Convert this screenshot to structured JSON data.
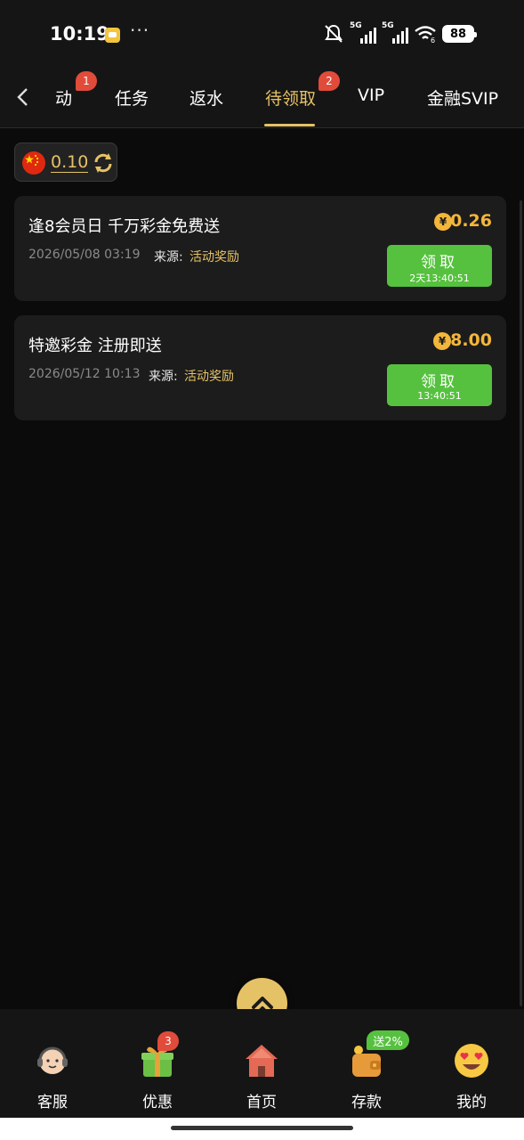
{
  "status_bar": {
    "time": "10:19",
    "dots": "···",
    "signal1_tag": "5G",
    "signal2_tag": "5G",
    "wifi_tag": "6",
    "battery": "88"
  },
  "tabs": {
    "items": [
      {
        "label": "动",
        "badge": "1"
      },
      {
        "label": "任务",
        "badge": ""
      },
      {
        "label": "返水",
        "badge": ""
      },
      {
        "label": "待领取",
        "badge": "2"
      },
      {
        "label": "VIP",
        "badge": ""
      },
      {
        "label": "金融SVIP",
        "badge": ""
      }
    ],
    "active_index": 3
  },
  "balance": {
    "value": "0.10"
  },
  "rewards": [
    {
      "title": "逢8会员日 千万彩金免费送",
      "date": "2026/05/08 03:19",
      "source_label": "来源:",
      "source_value": "活动奖励",
      "currency_symbol": "¥",
      "amount": "0.26",
      "claim_label": "领取",
      "timer": "2天13:40:51"
    },
    {
      "title": "特邀彩金 注册即送",
      "date": "2026/05/12 10:13",
      "source_label": "来源:",
      "source_value": "活动奖励",
      "currency_symbol": "¥",
      "amount": "8.00",
      "claim_label": "领取",
      "timer": "13:40:51"
    }
  ],
  "bottom_nav": {
    "items": [
      {
        "label": "客服",
        "icon": "customer-service-icon"
      },
      {
        "label": "优惠",
        "icon": "gift-icon",
        "badge": "3"
      },
      {
        "label": "首页",
        "icon": "home-icon"
      },
      {
        "label": "存款",
        "icon": "wallet-icon",
        "tag": "送2%"
      },
      {
        "label": "我的",
        "icon": "heart-eyes-emoji-icon"
      }
    ]
  },
  "colors": {
    "accent_gold": "#e6c266",
    "claim_green": "#56c13f",
    "badge_red": "#e04b3a",
    "coin_orange": "#f4b63a"
  }
}
